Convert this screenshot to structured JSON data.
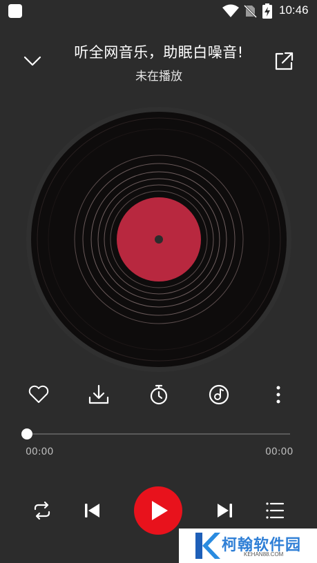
{
  "status_bar": {
    "time": "10:46",
    "icons": [
      "app-icon",
      "wifi-icon",
      "no-sim-icon",
      "battery-charging-icon"
    ]
  },
  "header": {
    "title": "听全网音乐，助眠白噪音!",
    "subtitle": "未在播放"
  },
  "actions": [
    "heart-icon",
    "download-icon",
    "timer-icon",
    "sound-effect-icon",
    "more-vertical-icon"
  ],
  "progress": {
    "current_time": "00:00",
    "total_time": "00:00",
    "position": 0
  },
  "controls": [
    "repeat-icon",
    "previous-icon",
    "play-icon",
    "next-icon",
    "playlist-icon"
  ],
  "colors": {
    "background": "#2c2c2c",
    "accent": "#e8121c",
    "disc_label": "#b8283f"
  },
  "watermark": {
    "text": "柯翰软件园",
    "url": "KEHAN88.COM"
  }
}
